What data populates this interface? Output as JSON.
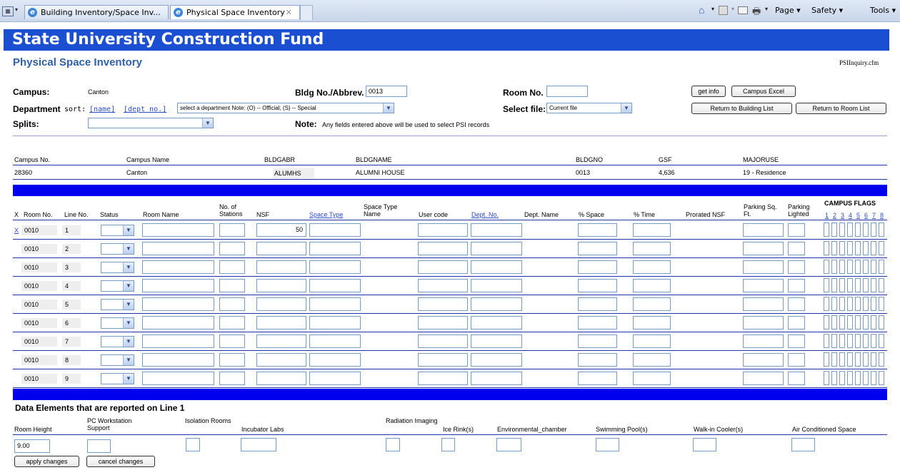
{
  "browser": {
    "tabs": [
      "Building Inventory/Space Inv...",
      "Physical Space Inventory"
    ],
    "toolbar": {
      "page": "Page",
      "safety": "Safety",
      "tools": "Tools"
    }
  },
  "banner": "State University Construction Fund",
  "page_title": "Physical Space Inventory",
  "filename": "PSIInquiry.cfm",
  "form": {
    "campus_label": "Campus:",
    "campus_value": "Canton",
    "department_label": "Department",
    "sort_label": "sort:",
    "sort_name": "[name]",
    "sort_dept": "[dept no.]",
    "department_select": "select a department Note: (O) -- Official; (S) -- Special",
    "splits_label": "Splits:",
    "splits_value": "",
    "bldg_label": "Bldg No./Abbrev.",
    "bldg_value": "0013",
    "note_label": "Note:",
    "note_text": "Any fields entered above will be used to select PSI records",
    "room_label": "Room No.",
    "room_value": "",
    "select_file_label": "Select file:",
    "select_file_value": "Current file",
    "get_info": "get info",
    "campus_excel": "Campus Excel",
    "return_building": "Return to Building List",
    "return_room": "Return to Room List"
  },
  "info": {
    "headers": [
      "Campus No.",
      "Campus Name",
      "BLDGABR",
      "BLDGNAME",
      "BLDGNO",
      "GSF",
      "MAJORUSE"
    ],
    "values": [
      "28360",
      "Canton",
      "ALUMHS",
      "ALUMNI HOUSE",
      "0013",
      "4,636",
      "19 - Residence"
    ]
  },
  "grid": {
    "headers": {
      "x": "X",
      "room_no": "Room No.",
      "line_no": "Line No.",
      "status": "Status",
      "room_name": "Room Name",
      "stations": "No. of Stations",
      "nsf": "NSF",
      "space_type": "Space Type",
      "space_type_name": "Space Type Name",
      "user_code": "User code",
      "dept_no": "Dept. No.",
      "dept_name": "Dept. Name",
      "pct_space": "% Space",
      "pct_time": "% Time",
      "prorated_nsf": "Prorated NSF",
      "parking_sqft": "Parking Sq. Ft.",
      "parking_lighted": "Parking Lighted",
      "campus_flags": "CAMPUS FLAGS",
      "flag_numbers": [
        "1",
        "2",
        "3",
        "4",
        "5",
        "6",
        "7",
        "8"
      ]
    },
    "x_link": "X",
    "rows": [
      {
        "room": "0010",
        "line": "1",
        "nsf": "50"
      },
      {
        "room": "0010",
        "line": "2",
        "nsf": ""
      },
      {
        "room": "0010",
        "line": "3",
        "nsf": ""
      },
      {
        "room": "0010",
        "line": "4",
        "nsf": ""
      },
      {
        "room": "0010",
        "line": "5",
        "nsf": ""
      },
      {
        "room": "0010",
        "line": "6",
        "nsf": ""
      },
      {
        "room": "0010",
        "line": "7",
        "nsf": ""
      },
      {
        "room": "0010",
        "line": "8",
        "nsf": ""
      },
      {
        "room": "0010",
        "line": "9",
        "nsf": ""
      }
    ]
  },
  "data_elements": {
    "title": "Data Elements that are reported on Line 1",
    "fields": [
      "Room Height",
      "PC Workstation Support",
      "Isolation Rooms",
      "Incubator Labs",
      "Radiation Imaging",
      "Ice Rink(s)",
      "Environmental_chamber",
      "Swimming Pool(s)",
      "Walk-in Cooler(s)",
      "Air Conditioned Space"
    ],
    "room_height_value": "9.00"
  },
  "buttons": {
    "apply": "apply changes",
    "cancel": "cancel changes"
  }
}
